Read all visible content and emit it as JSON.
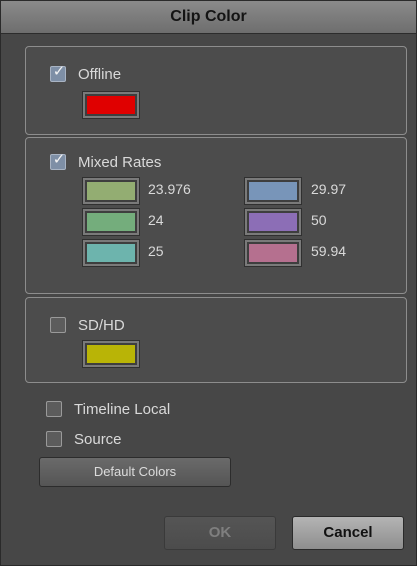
{
  "window": {
    "title": "Clip Color"
  },
  "offline": {
    "label": "Offline",
    "checked": true,
    "color": "#e00000"
  },
  "mixed_rates": {
    "label": "Mixed Rates",
    "checked": true,
    "rates": [
      {
        "label": "23.976",
        "color": "#93ad72"
      },
      {
        "label": "24",
        "color": "#74ad7c"
      },
      {
        "label": "25",
        "color": "#6db4ad"
      },
      {
        "label": "29.97",
        "color": "#7895b9"
      },
      {
        "label": "50",
        "color": "#8c6eb6"
      },
      {
        "label": "59.94",
        "color": "#b5708f"
      }
    ]
  },
  "sdhd": {
    "label": "SD/HD",
    "checked": false,
    "color": "#b9b406"
  },
  "options": {
    "timeline_local": {
      "label": "Timeline Local",
      "checked": false
    },
    "source": {
      "label": "Source",
      "checked": false
    }
  },
  "buttons": {
    "default_colors": "Default Colors",
    "ok": "OK",
    "cancel": "Cancel"
  },
  "colors": {
    "panel": "#474747",
    "group_border": "#8d8d8d",
    "text": "#d9d9d9"
  }
}
